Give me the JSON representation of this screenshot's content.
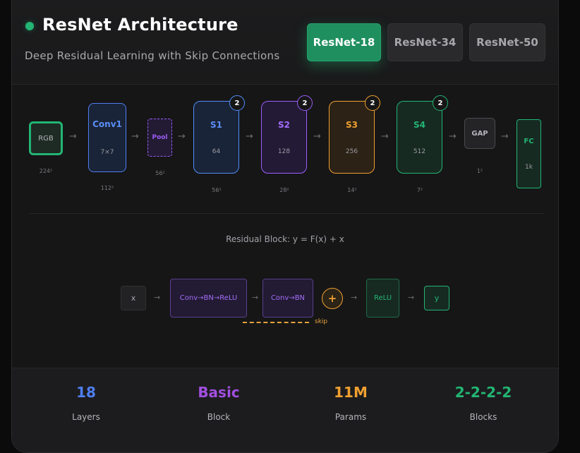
{
  "header": {
    "title": "ResNet Architecture",
    "subtitle": "Deep Residual Learning with Skip Connections",
    "status_color": "#22b573"
  },
  "tabs": [
    {
      "label": "ResNet-18",
      "active": true
    },
    {
      "label": "ResNet-34",
      "active": false
    },
    {
      "label": "ResNet-50",
      "active": false
    }
  ],
  "pipeline": {
    "input": {
      "label": "RGB",
      "resolution": "224²"
    },
    "conv1": {
      "label": "Conv1",
      "detail": "7×7",
      "resolution": "112²"
    },
    "pool": {
      "label": "Pool",
      "resolution": "56²"
    },
    "stages": [
      {
        "label": "S1",
        "channels": "64",
        "blocks": "2",
        "resolution": "56²",
        "color": "#4f8ef7"
      },
      {
        "label": "S2",
        "channels": "128",
        "blocks": "2",
        "resolution": "28²",
        "color": "#9b5cf6"
      },
      {
        "label": "S3",
        "channels": "256",
        "blocks": "2",
        "resolution": "14²",
        "color": "#f0a030"
      },
      {
        "label": "S4",
        "channels": "512",
        "blocks": "2",
        "resolution": "7²",
        "color": "#22b573"
      }
    ],
    "gap": {
      "label": "GAP",
      "resolution": "1²"
    },
    "fc": {
      "label": "FC",
      "detail": "1k"
    }
  },
  "residual_block": {
    "title": "Residual Block: y = F(x) + x",
    "input": "x",
    "conv1": "Conv→BN→ReLU",
    "conv2": "Conv→BN",
    "add": "+",
    "relu": "ReLU",
    "output": "y",
    "skip_label": "skip"
  },
  "stats": [
    {
      "value": "18",
      "label": "Layers",
      "color": "#4f7ef0"
    },
    {
      "value": "Basic",
      "label": "Block",
      "color": "#a24fe0"
    },
    {
      "value": "11M",
      "label": "Params",
      "color": "#f0a030"
    },
    {
      "value": "2-2-2-2",
      "label": "Blocks",
      "color": "#22b573"
    }
  ]
}
